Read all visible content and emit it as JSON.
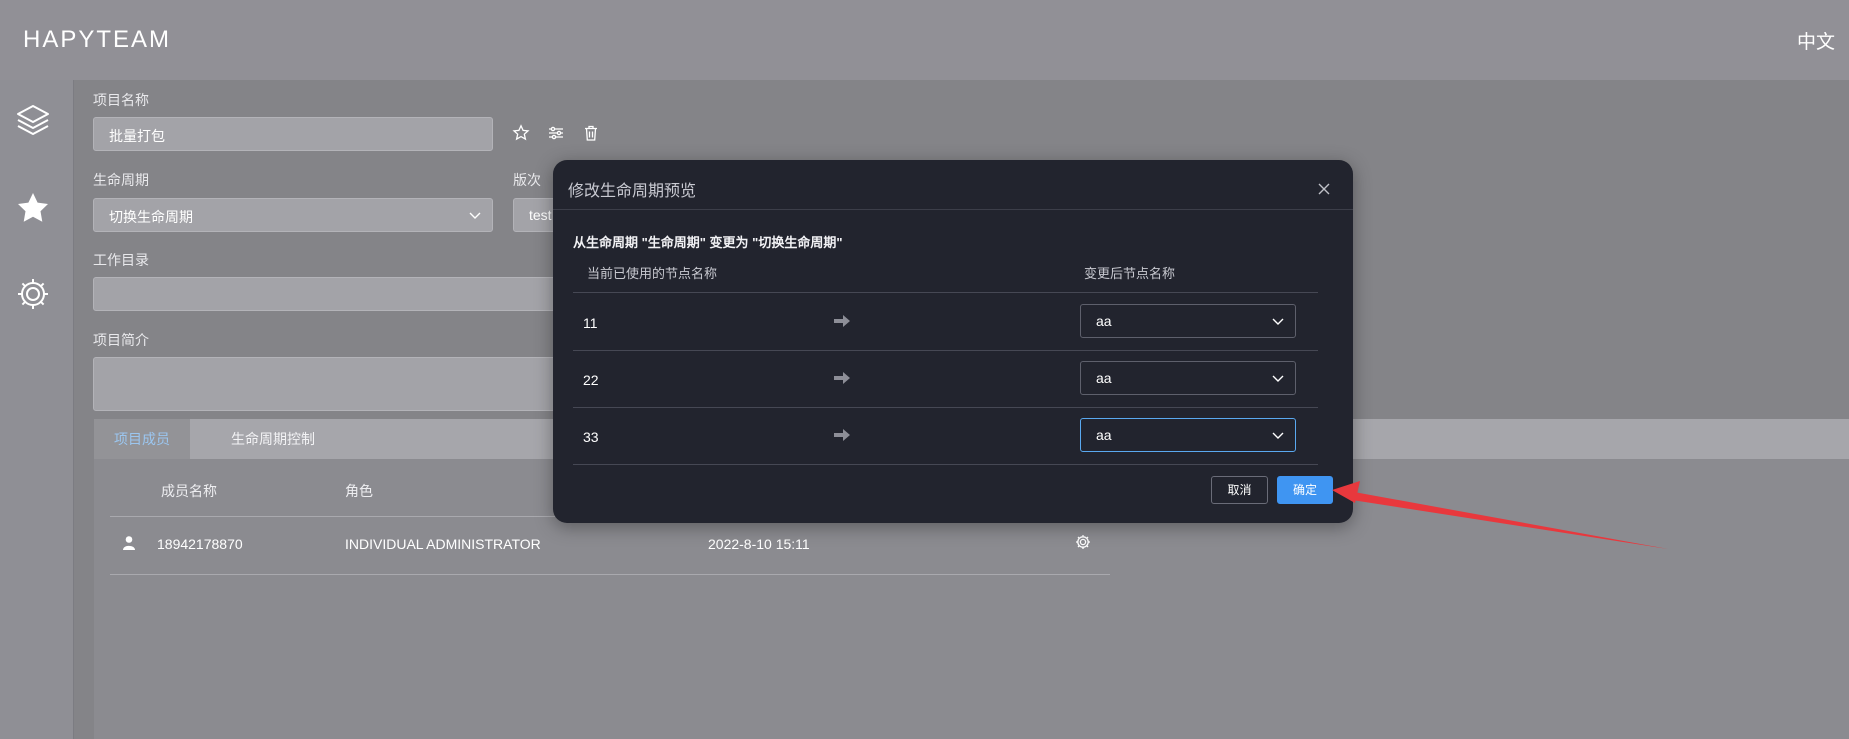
{
  "header": {
    "brand": "HAPYTEAM",
    "language": "中文"
  },
  "sidebar": {
    "icons": [
      "layers-icon",
      "star-icon",
      "gear-icon"
    ]
  },
  "form": {
    "project_name_label": "项目名称",
    "project_name_value": "批量打包",
    "lifecycle_label": "生命周期",
    "lifecycle_value": "切换生命周期",
    "version_label": "版次",
    "version_value": "test",
    "workdir_label": "工作目录",
    "workdir_value": "",
    "intro_label": "项目简介",
    "intro_value": ""
  },
  "tabs": [
    {
      "label": "项目成员",
      "active": true
    },
    {
      "label": "生命周期控制",
      "active": false
    }
  ],
  "members": {
    "headers": [
      "成员名称",
      "角色"
    ],
    "rows": [
      {
        "name": "18942178870",
        "role": "INDIVIDUAL ADMINISTRATOR",
        "time": "2022-8-10 15:11"
      }
    ]
  },
  "modal": {
    "title": "修改生命周期预览",
    "description": "从生命周期 \"生命周期\" 变更为 \"切换生命周期\"",
    "col_current": "当前已使用的节点名称",
    "col_new": "变更后节点名称",
    "rows": [
      {
        "current": "11",
        "target": "aa"
      },
      {
        "current": "22",
        "target": "aa"
      },
      {
        "current": "33",
        "target": "aa"
      }
    ],
    "cancel_label": "取消",
    "ok_label": "确定"
  },
  "colors": {
    "accent": "#3f95f2",
    "annotation_arrow": "#e8383d"
  }
}
